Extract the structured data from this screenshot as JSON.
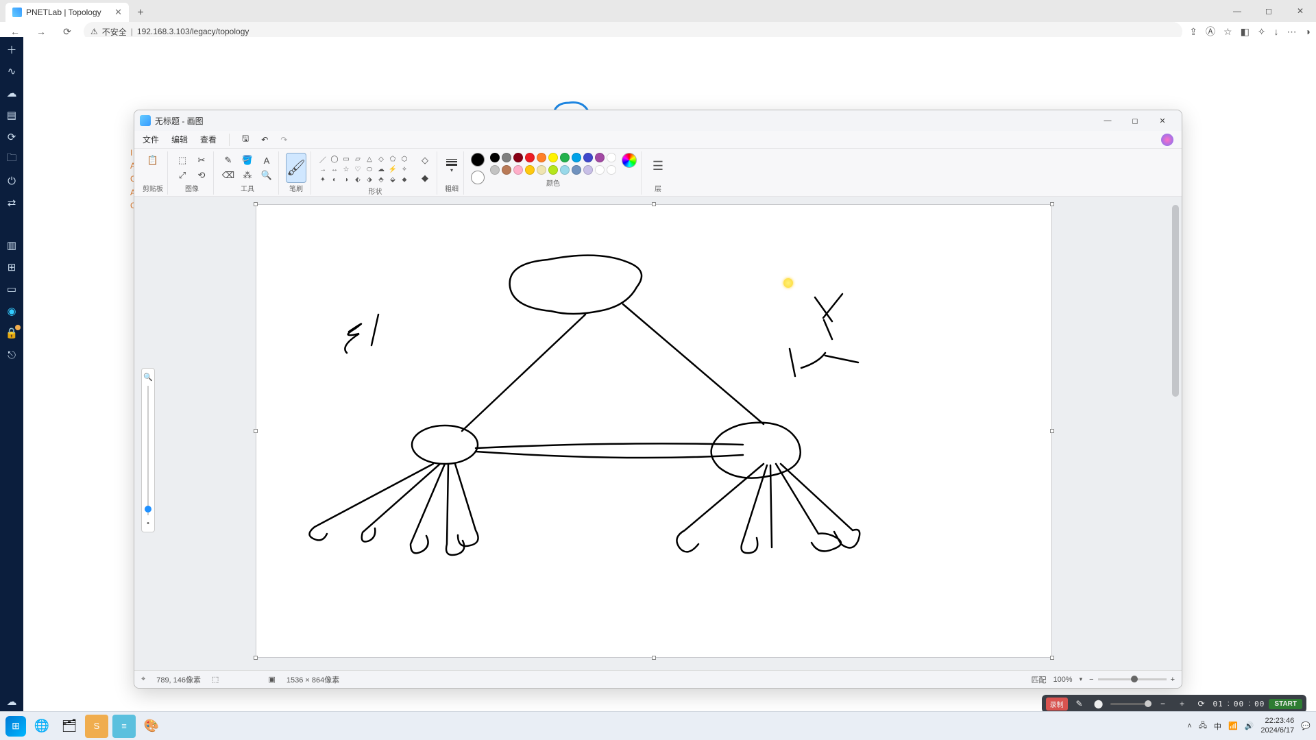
{
  "browser": {
    "tab_title": "PNETLab | Topology",
    "url": "192.168.3.103/legacy/topology",
    "insecure_label": "不安全"
  },
  "paint": {
    "title": "无标题 - 画图",
    "menu": {
      "file": "文件",
      "edit": "编辑",
      "view": "查看"
    },
    "groups": {
      "clipboard": "剪贴板",
      "image": "图像",
      "tools": "工具",
      "brush": "笔刷",
      "shapes": "形状",
      "size": "粗细",
      "colors": "颜色",
      "layers": "层"
    },
    "status": {
      "pos": "789, 146像素",
      "size": "1536 × 864像素",
      "fit": "匹配",
      "zoom": "100%"
    }
  },
  "palette_row1": [
    "#000000",
    "#7f7f7f",
    "#880015",
    "#ed1c24",
    "#ff7f27",
    "#fff200",
    "#22b14c",
    "#00a2e8",
    "#3f48cc",
    "#a349a4",
    "#ffffff"
  ],
  "palette_row2": [
    "#c3c3c3",
    "#b97a57",
    "#ffaec9",
    "#ffc90e",
    "#efe4b0",
    "#b5e61d",
    "#99d9ea",
    "#7092be",
    "#c8bfe7",
    "#ffffff",
    "#ffffff"
  ],
  "recorder": {
    "label": "录制",
    "time_h": "01",
    "time_m": "00",
    "time_s": "00",
    "start": "START"
  },
  "tray": {
    "time": "22:23:46",
    "date": "2024/6/17"
  }
}
